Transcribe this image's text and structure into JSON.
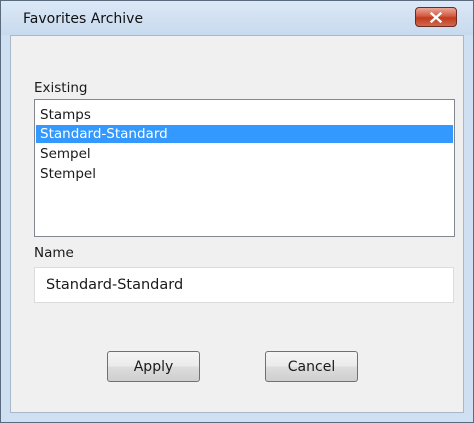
{
  "dialog": {
    "title": "Favorites Archive",
    "close_icon": "close-icon"
  },
  "existing": {
    "label": "Existing",
    "items": [
      {
        "label": "Stamps",
        "selected": false
      },
      {
        "label": "Standard-Standard",
        "selected": true
      },
      {
        "label": "Sempel",
        "selected": false
      },
      {
        "label": "Stempel",
        "selected": false
      }
    ]
  },
  "name": {
    "label": "Name",
    "value": "Standard-Standard"
  },
  "buttons": {
    "apply_label": "Apply",
    "cancel_label": "Cancel"
  },
  "colors": {
    "selection": "#3399ff",
    "close_button": "#c13a1f",
    "title_bar": "#cfe0f2"
  }
}
